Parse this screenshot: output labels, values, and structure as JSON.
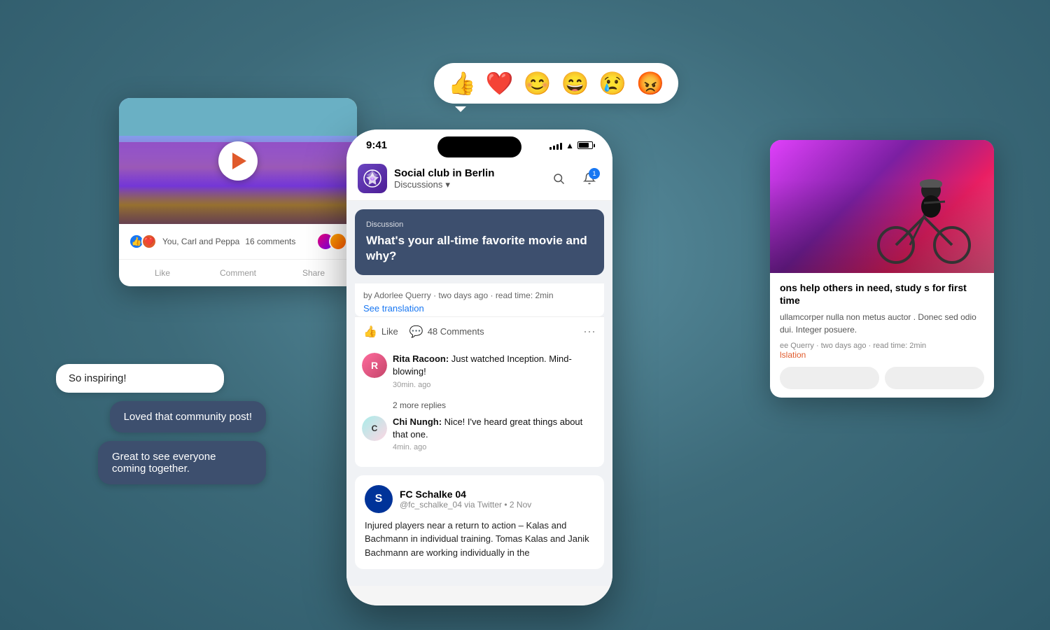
{
  "background": {
    "color": "#4a7a8a"
  },
  "reactions": {
    "emojis": [
      "👍",
      "❤️",
      "😊",
      "😄",
      "😢",
      "😡"
    ]
  },
  "left_card": {
    "like_text": "You, Carl and Peppa",
    "comment_count": "16 comments",
    "action_like": "Like",
    "action_comment": "Comment",
    "action_share": "Share"
  },
  "chat_bubbles": [
    {
      "text": "So inspiring!",
      "type": "light"
    },
    {
      "text": "Loved that community post!",
      "type": "dark"
    },
    {
      "text": "Great to see everyone coming together.",
      "type": "dark"
    }
  ],
  "phone": {
    "status_time": "9:41",
    "header": {
      "title": "Social club in Berlin",
      "subtitle": "Discussions",
      "notification_count": "1"
    },
    "discussion": {
      "label": "Discussion",
      "title": "What's your all-time favorite movie and why?"
    },
    "post_meta": {
      "author": "by Adorlee Querry",
      "time": "two days ago",
      "read_time": "read time: 2min",
      "see_translation": "See translation"
    },
    "actions": {
      "like": "Like",
      "comments": "48 Comments"
    },
    "comments": [
      {
        "author": "Rita Racoon:",
        "text": "Just watched Inception. Mind-blowing!",
        "time": "30min. ago",
        "avatar_letter": "R"
      },
      {
        "more_replies": "2 more replies"
      },
      {
        "author": "Chi Nungh:",
        "text": "Nice! I've heard great things about that one.",
        "time": "4min. ago",
        "avatar_letter": "C"
      }
    ],
    "social_post": {
      "source": "FC Schalke 04",
      "handle": "@fc_schalke_04 via Twitter • 2 Nov",
      "text": "Injured players near a return to action – Kalas and Bachmann in individual training. Tomas Kalas and Janik Bachmann are working individually in the",
      "logo_letter": "S"
    }
  },
  "right_card": {
    "title": "ons help others in need, study s for first time",
    "body": "ullamcorper nulla non metus auctor . Donec sed odio dui. Integer posuere.",
    "meta_author": "ee Querry",
    "meta_time": "two days ago",
    "meta_read": "read time: 2min",
    "translation": "lslation"
  }
}
